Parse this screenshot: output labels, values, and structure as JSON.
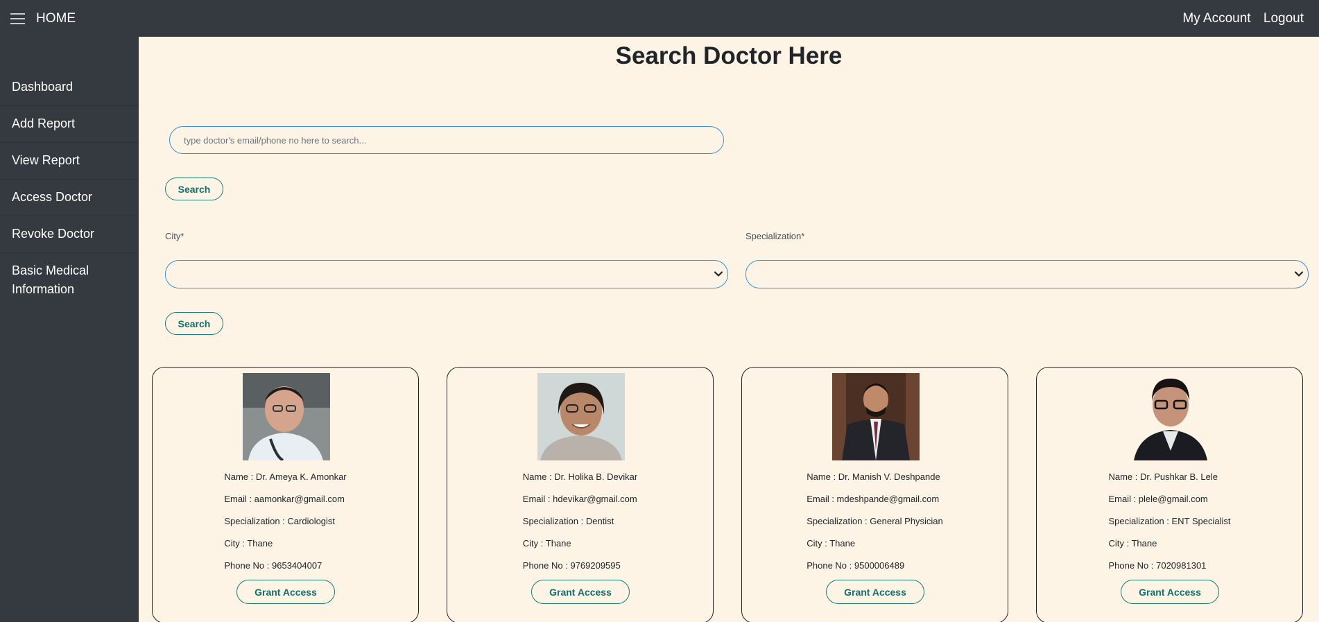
{
  "topbar": {
    "home_label": "HOME",
    "my_account_label": "My Account",
    "logout_label": "Logout"
  },
  "sidebar": {
    "items": [
      {
        "label": "Dashboard"
      },
      {
        "label": "Add Report"
      },
      {
        "label": "View Report"
      },
      {
        "label": "Access Doctor"
      },
      {
        "label": "Revoke Doctor"
      },
      {
        "label": "Basic Medical Information"
      }
    ]
  },
  "main": {
    "title": "Search Doctor Here",
    "search": {
      "placeholder": "type doctor's email/phone no here to search...",
      "value": "",
      "button_label": "Search"
    },
    "filters": {
      "city_label": "City*",
      "city_value": "",
      "specialization_label": "Specialization*",
      "specialization_value": "",
      "button_label": "Search"
    },
    "doctors": [
      {
        "name": "Name : Dr. Ameya K. Amonkar",
        "email": "Email : aamonkar@gmail.com",
        "specialization": "Specialization : Cardiologist",
        "city": "City : Thane",
        "phone": "Phone No : 9653404007",
        "button_label": "Grant Access"
      },
      {
        "name": "Name : Dr. Holika B. Devikar",
        "email": "Email : hdevikar@gmail.com",
        "specialization": "Specialization : Dentist",
        "city": "City : Thane",
        "phone": "Phone No : 9769209595",
        "button_label": "Grant Access"
      },
      {
        "name": "Name : Dr. Manish V. Deshpande",
        "email": "Email : mdeshpande@gmail.com",
        "specialization": "Specialization : General Physician",
        "city": "City : Thane",
        "phone": "Phone No : 9500006489",
        "button_label": "Grant Access"
      },
      {
        "name": "Name : Dr. Pushkar B. Lele",
        "email": "Email : plele@gmail.com",
        "specialization": "Specialization : ENT Specialist",
        "city": "City : Thane",
        "phone": "Phone No : 7020981301",
        "button_label": "Grant Access"
      }
    ]
  },
  "colors": {
    "nav_bg": "#343a40",
    "page_bg": "#fdf4e6",
    "accent": "#10706a",
    "input_border": "#3d8fd1"
  },
  "icons": {
    "menu": "hamburger-menu-icon",
    "select": "chevron-down-icon"
  }
}
